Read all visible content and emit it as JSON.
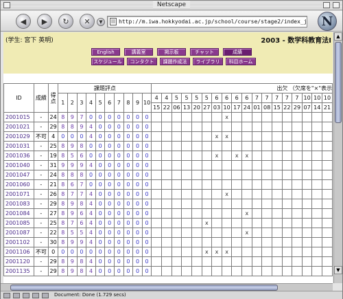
{
  "window": {
    "title": "Netscape"
  },
  "toolbar": {
    "url": "http://m.iwa.hokkyodai.ac.jp/school/course/stage2/index_j.phtml"
  },
  "status": {
    "text": "Document: Done (1.729 secs)"
  },
  "header": {
    "student": "(学生: 宮下 英明)",
    "course": "2003 - 数学科教育法I",
    "nav_row1": [
      "English",
      "講義室",
      "掲示板",
      "チャット",
      "成績"
    ],
    "nav_row2": [
      "スケジュール",
      "コンタクト",
      "課題作成法",
      "ライブラリ",
      "科目ホーム"
    ]
  },
  "table": {
    "col_id": "ID",
    "col_grade": "成績",
    "col_total": "得点",
    "group_scores": "課題評点",
    "group_attendance": "出欠 （欠席を\"×\"表示",
    "score_nums": [
      "1",
      "2",
      "3",
      "4",
      "5",
      "6",
      "7",
      "8",
      "9",
      "10"
    ],
    "date_months": [
      "4",
      "4",
      "5",
      "5",
      "5",
      "5",
      "6",
      "6",
      "6",
      "6",
      "7",
      "7",
      "7",
      "7",
      "7",
      "10",
      "10",
      "10"
    ],
    "date_days": [
      "15",
      "22",
      "06",
      "13",
      "20",
      "27",
      "03",
      "10",
      "17",
      "24",
      "01",
      "08",
      "15",
      "22",
      "29",
      "07",
      "14",
      "21"
    ],
    "rows": [
      {
        "id": "2001015",
        "grade": "-",
        "total": "24",
        "scores": [
          "8",
          "9",
          "7",
          "0",
          "0",
          "0",
          "0",
          "0",
          "0",
          "0"
        ],
        "marks": [
          "",
          "",
          "",
          "",
          "",
          "",
          "",
          "x",
          "",
          "",
          "",
          "",
          "",
          "",
          "",
          "",
          "",
          ""
        ]
      },
      {
        "id": "2001021",
        "grade": "-",
        "total": "29",
        "scores": [
          "8",
          "8",
          "9",
          "4",
          "0",
          "0",
          "0",
          "0",
          "0",
          "0"
        ],
        "marks": [
          "",
          "",
          "",
          "",
          "",
          "",
          "",
          "",
          "",
          "",
          "",
          "",
          "",
          "",
          "",
          "",
          "",
          ""
        ]
      },
      {
        "id": "2001029",
        "grade": "不可",
        "total": "4",
        "scores": [
          "0",
          "0",
          "0",
          "4",
          "0",
          "0",
          "0",
          "0",
          "0",
          "0"
        ],
        "marks": [
          "",
          "",
          "",
          "",
          "",
          "",
          "x",
          "x",
          "",
          "",
          "",
          "",
          "",
          "",
          "",
          "",
          "",
          ""
        ]
      },
      {
        "id": "2001031",
        "grade": "-",
        "total": "25",
        "scores": [
          "8",
          "9",
          "8",
          "0",
          "0",
          "0",
          "0",
          "0",
          "0",
          "0"
        ],
        "marks": [
          "",
          "",
          "",
          "",
          "",
          "",
          "",
          "",
          "",
          "",
          "",
          "",
          "",
          "",
          "",
          "",
          "",
          ""
        ]
      },
      {
        "id": "2001036",
        "grade": "-",
        "total": "19",
        "scores": [
          "8",
          "5",
          "6",
          "0",
          "0",
          "0",
          "0",
          "0",
          "0",
          "0"
        ],
        "marks": [
          "",
          "",
          "",
          "",
          "",
          "",
          "x",
          "",
          "x",
          "x",
          "",
          "",
          "",
          "",
          "",
          "",
          "",
          ""
        ]
      },
      {
        "id": "2001040",
        "grade": "-",
        "total": "31",
        "scores": [
          "9",
          "9",
          "9",
          "4",
          "0",
          "0",
          "0",
          "0",
          "0",
          "0"
        ],
        "marks": [
          "",
          "",
          "",
          "",
          "",
          "",
          "",
          "",
          "",
          "",
          "",
          "",
          "",
          "",
          "",
          "",
          "",
          ""
        ]
      },
      {
        "id": "2001047",
        "grade": "-",
        "total": "24",
        "scores": [
          "8",
          "8",
          "8",
          "0",
          "0",
          "0",
          "0",
          "0",
          "0",
          "0"
        ],
        "marks": [
          "",
          "",
          "",
          "",
          "",
          "",
          "",
          "",
          "",
          "",
          "",
          "",
          "",
          "",
          "",
          "",
          "",
          ""
        ]
      },
      {
        "id": "2001060",
        "grade": "-",
        "total": "21",
        "scores": [
          "8",
          "6",
          "7",
          "0",
          "0",
          "0",
          "0",
          "0",
          "0",
          "0"
        ],
        "marks": [
          "",
          "",
          "",
          "",
          "",
          "",
          "",
          "",
          "",
          "",
          "",
          "",
          "",
          "",
          "",
          "",
          "",
          ""
        ]
      },
      {
        "id": "2001071",
        "grade": "-",
        "total": "26",
        "scores": [
          "8",
          "7",
          "7",
          "4",
          "0",
          "0",
          "0",
          "0",
          "0",
          "0"
        ],
        "marks": [
          "",
          "",
          "",
          "",
          "",
          "",
          "",
          "x",
          "",
          "",
          "",
          "",
          "",
          "",
          "",
          "",
          "",
          ""
        ]
      },
      {
        "id": "2001083",
        "grade": "-",
        "total": "29",
        "scores": [
          "8",
          "9",
          "8",
          "4",
          "0",
          "0",
          "0",
          "0",
          "0",
          "0"
        ],
        "marks": [
          "",
          "",
          "",
          "",
          "",
          "",
          "",
          "",
          "",
          "",
          "",
          "",
          "",
          "",
          "",
          "",
          "",
          ""
        ]
      },
      {
        "id": "2001084",
        "grade": "-",
        "total": "27",
        "scores": [
          "8",
          "9",
          "6",
          "4",
          "0",
          "0",
          "0",
          "0",
          "0",
          "0"
        ],
        "marks": [
          "",
          "",
          "",
          "",
          "",
          "",
          "",
          "",
          "",
          "x",
          "",
          "",
          "",
          "",
          "",
          "",
          "",
          ""
        ]
      },
      {
        "id": "2001085",
        "grade": "-",
        "total": "25",
        "scores": [
          "8",
          "7",
          "6",
          "4",
          "0",
          "0",
          "0",
          "0",
          "0",
          "0"
        ],
        "marks": [
          "",
          "",
          "",
          "",
          "",
          "x",
          "",
          "",
          "",
          "",
          "",
          "",
          "",
          "",
          "",
          "",
          "",
          ""
        ]
      },
      {
        "id": "2001087",
        "grade": "-",
        "total": "22",
        "scores": [
          "8",
          "5",
          "5",
          "4",
          "0",
          "0",
          "0",
          "0",
          "0",
          "0"
        ],
        "marks": [
          "",
          "",
          "",
          "",
          "",
          "",
          "",
          "",
          "",
          "x",
          "",
          "",
          "",
          "",
          "",
          "",
          "",
          ""
        ]
      },
      {
        "id": "2001102",
        "grade": "-",
        "total": "30",
        "scores": [
          "8",
          "9",
          "9",
          "4",
          "0",
          "0",
          "0",
          "0",
          "0",
          "0"
        ],
        "marks": [
          "",
          "",
          "",
          "",
          "",
          "",
          "",
          "",
          "",
          "",
          "",
          "",
          "",
          "",
          "",
          "",
          "",
          ""
        ]
      },
      {
        "id": "2001106",
        "grade": "不可",
        "total": "0",
        "scores": [
          "0",
          "0",
          "0",
          "0",
          "0",
          "0",
          "0",
          "0",
          "0",
          "0"
        ],
        "marks": [
          "",
          "",
          "",
          "",
          "",
          "x",
          "x",
          "x",
          "",
          "",
          "",
          "",
          "",
          "",
          "",
          "",
          "",
          ""
        ]
      },
      {
        "id": "2001120",
        "grade": "-",
        "total": "29",
        "scores": [
          "8",
          "9",
          "8",
          "4",
          "0",
          "0",
          "0",
          "0",
          "0",
          "0"
        ],
        "marks": [
          "",
          "",
          "",
          "",
          "",
          "",
          "",
          "",
          "",
          "",
          "",
          "",
          "",
          "",
          "",
          "",
          "",
          ""
        ]
      },
      {
        "id": "2001135",
        "grade": "-",
        "total": "29",
        "scores": [
          "8",
          "9",
          "8",
          "4",
          "0",
          "0",
          "0",
          "0",
          "0",
          "0"
        ],
        "marks": [
          "",
          "",
          "",
          "",
          "",
          "",
          "",
          "",
          "",
          "",
          "",
          "",
          "",
          "",
          "",
          "",
          "",
          ""
        ]
      }
    ]
  }
}
